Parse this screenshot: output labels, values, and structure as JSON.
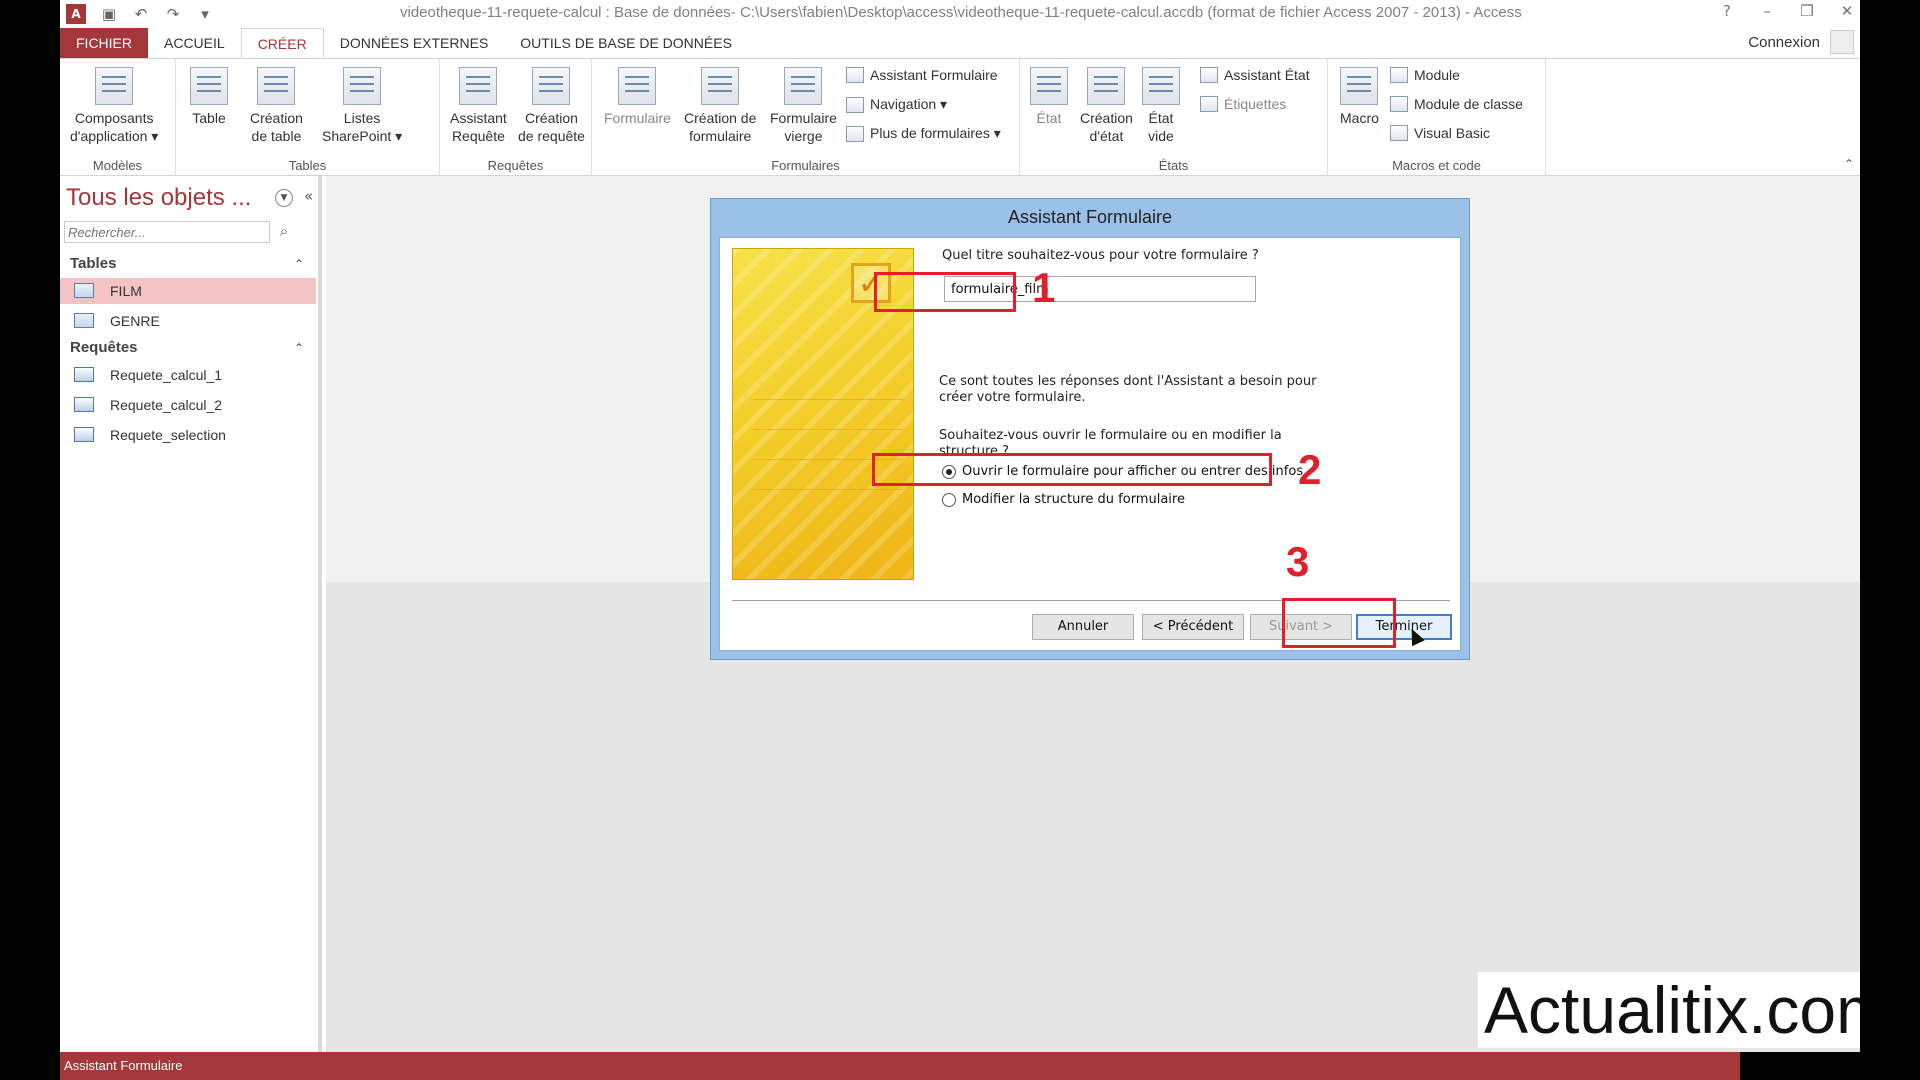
{
  "window": {
    "title": "videotheque-11-requete-calcul : Base de données- C:\\Users\\fabien\\Desktop\\access\\videotheque-11-requete-calcul.accdb (format de fichier Access 2007 - 2013) - Access",
    "app_icon": "A"
  },
  "tabs": [
    "FICHIER",
    "ACCUEIL",
    "CRÉER",
    "DONNÉES EXTERNES",
    "OUTILS DE BASE DE DONNÉES"
  ],
  "connexion": "Connexion",
  "ribbon": {
    "modeles": {
      "label": "Modèles",
      "composants": "Composants\nd'application ▾"
    },
    "tables": {
      "label": "Tables",
      "table": "Table",
      "creation_table": "Création\nde table",
      "listes": "Listes\nSharePoint ▾"
    },
    "requetes": {
      "label": "Requêtes",
      "assistant": "Assistant\nRequête",
      "creation": "Création\nde requête"
    },
    "formulaires": {
      "label": "Formulaires",
      "formulaire": "Formulaire",
      "creation": "Création de\nformulaire",
      "vierge": "Formulaire\nvierge",
      "assistant": "Assistant Formulaire",
      "navigation": "Navigation ▾",
      "plus": "Plus de formulaires ▾"
    },
    "etats": {
      "label": "États",
      "etat": "État",
      "creation": "Création\nd'état",
      "vide": "État\nvide",
      "assistant": "Assistant État",
      "etiquettes": "Étiquettes"
    },
    "macros": {
      "label": "Macros et code",
      "macro": "Macro",
      "module": "Module",
      "module_classe": "Module de classe",
      "vb": "Visual Basic"
    }
  },
  "nav": {
    "title": "Tous les objets ...",
    "search_placeholder": "Rechercher...",
    "sections": [
      {
        "name": "Tables",
        "items": [
          "FILM",
          "GENRE"
        ]
      },
      {
        "name": "Requêtes",
        "items": [
          "Requete_calcul_1",
          "Requete_calcul_2",
          "Requete_selection"
        ]
      }
    ]
  },
  "dialog": {
    "title": "Assistant Formulaire",
    "question_title": "Quel titre souhaitez-vous pour votre formulaire ?",
    "title_value": "formulaire_film",
    "info": "Ce sont toutes les réponses dont l'Assistant a besoin pour créer votre formulaire.",
    "question_open": "Souhaitez-vous ouvrir le formulaire ou en modifier la structure ?",
    "option_open": "Ouvrir le formulaire pour afficher ou entrer des infos",
    "option_modify": "Modifier la structure du formulaire",
    "buttons": {
      "cancel": "Annuler",
      "prev": "< Précédent",
      "next": "Suivant >",
      "finish": "Terminer"
    }
  },
  "annotations": [
    "1",
    "2",
    "3"
  ],
  "watermark": "Actualitix.com",
  "status": "Assistant Formulaire",
  "colors": {
    "accent": "#a4373a",
    "annotation": "#e0202a",
    "dialog_frame": "#9cc1e8"
  }
}
